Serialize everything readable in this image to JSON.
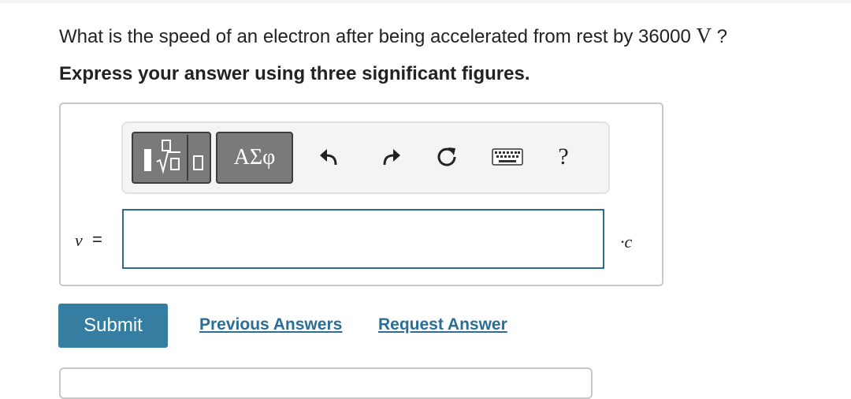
{
  "question": {
    "prefix": "What is the speed of an electron after being accelerated from rest by 36000",
    "unit": "V",
    "suffix": "?"
  },
  "instruction": "Express your answer using three significant figures.",
  "toolbar": {
    "greek_label": "ΑΣφ",
    "help_label": "?",
    "icons": [
      "templates-icon",
      "greek-letters-icon",
      "undo-icon",
      "redo-icon",
      "reset-icon",
      "keyboard-icon",
      "help-icon"
    ]
  },
  "answer": {
    "variable": "v",
    "equals": "=",
    "value": "",
    "unit": "·c"
  },
  "actions": {
    "submit_label": "Submit",
    "previous_answers_label": "Previous Answers",
    "request_answer_label": "Request Answer"
  },
  "colors": {
    "submit_bg": "#357ea1",
    "link": "#2a6e96",
    "input_border": "#2e6b86",
    "tool_button_bg": "#7a7a7a"
  }
}
